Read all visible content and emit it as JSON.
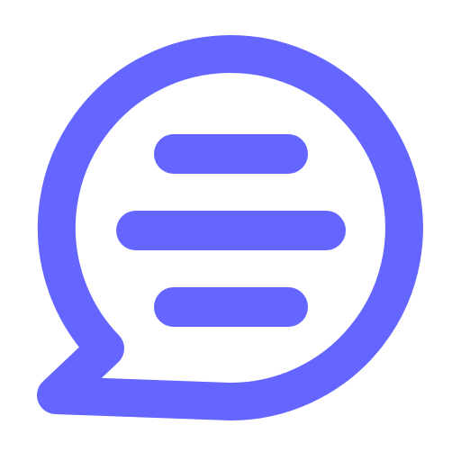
{
  "icon": {
    "name": "chat-bubble-icon",
    "line_count": 3
  },
  "colors": {
    "background": "#ffffff",
    "stroke": "#6466FF"
  }
}
